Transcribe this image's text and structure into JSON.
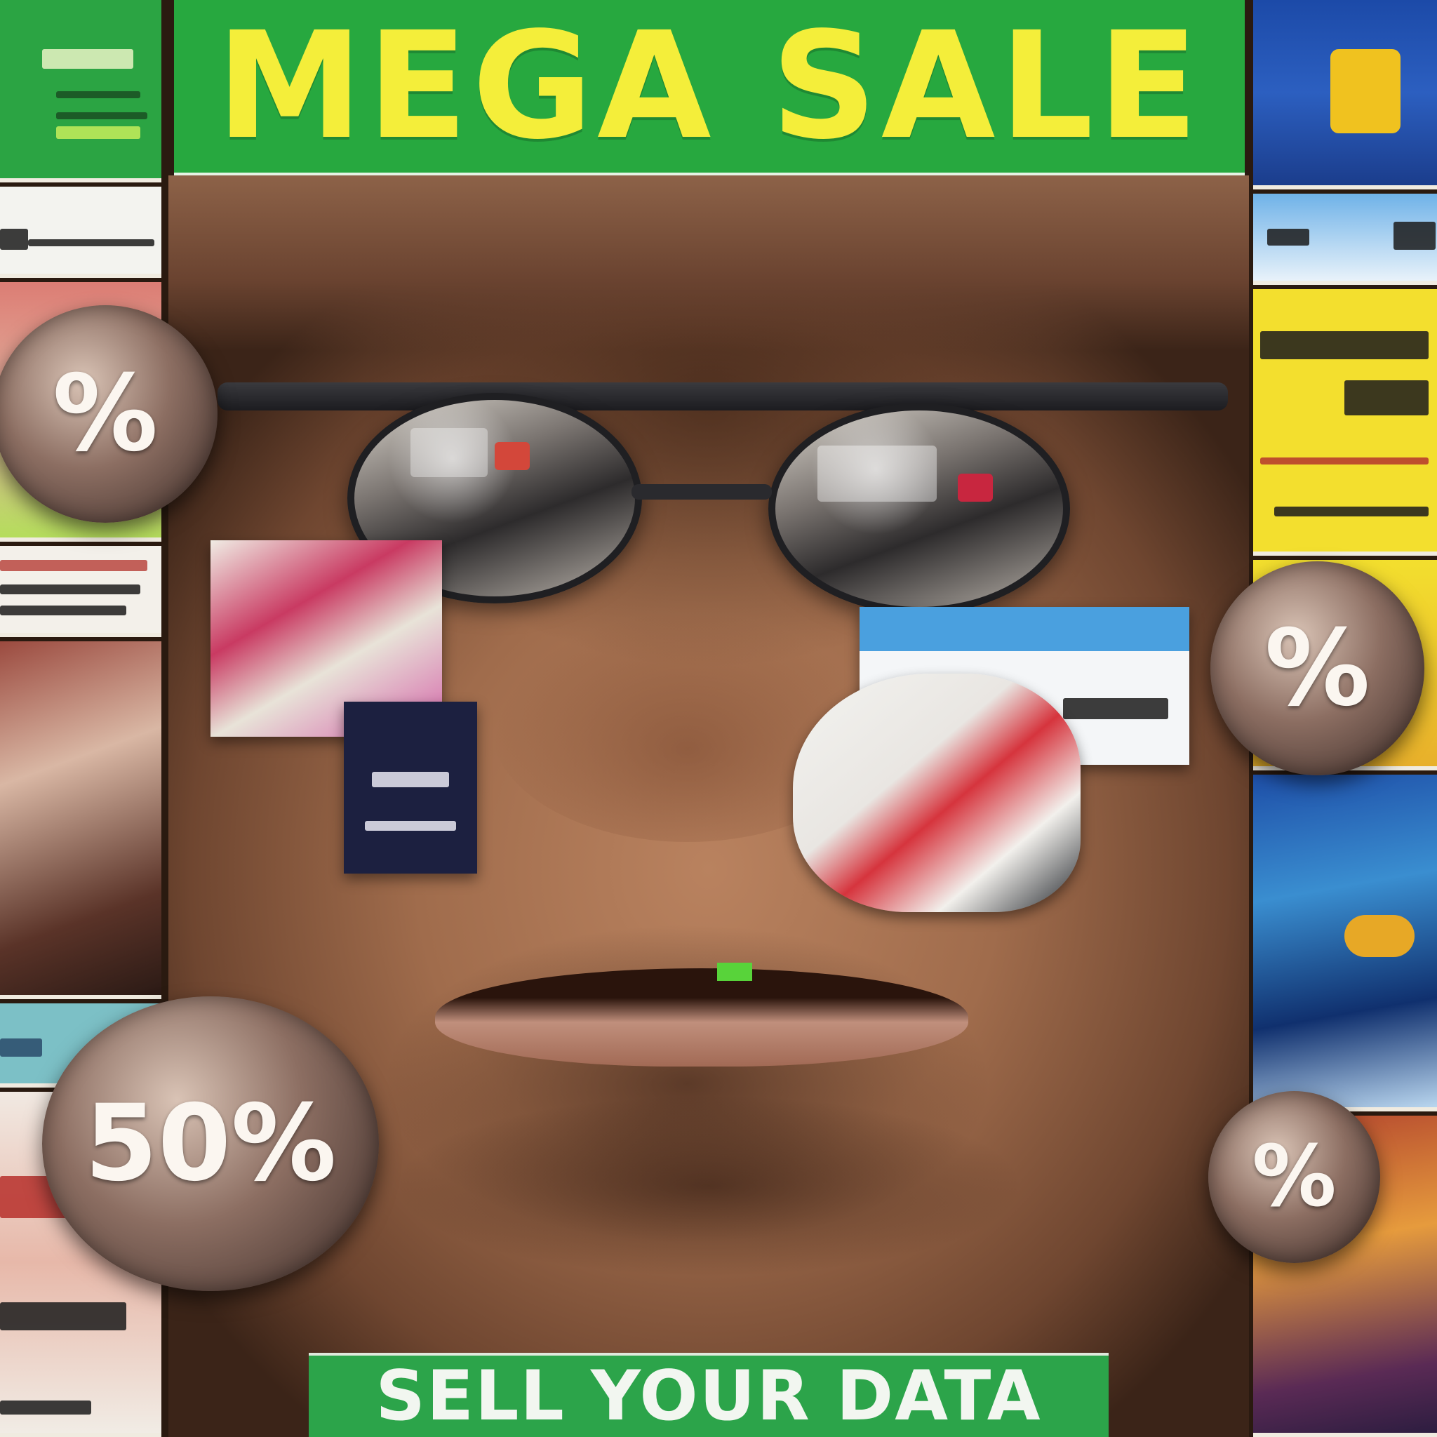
{
  "banner": {
    "title": "MEGA SALE"
  },
  "footer_banner": {
    "text": "SELL YOUR DATA"
  },
  "badges": [
    {
      "id": "left-top",
      "label": "%"
    },
    {
      "id": "left-bottom",
      "label": "50%"
    },
    {
      "id": "right-middle",
      "label": "%"
    },
    {
      "id": "right-bottom",
      "label": "%"
    }
  ],
  "colors": {
    "banner_green": "#27a83f",
    "banner_text_yellow": "#f4ee3a",
    "footer_green": "#2ca44a",
    "footer_text": "#f2f6f0"
  }
}
